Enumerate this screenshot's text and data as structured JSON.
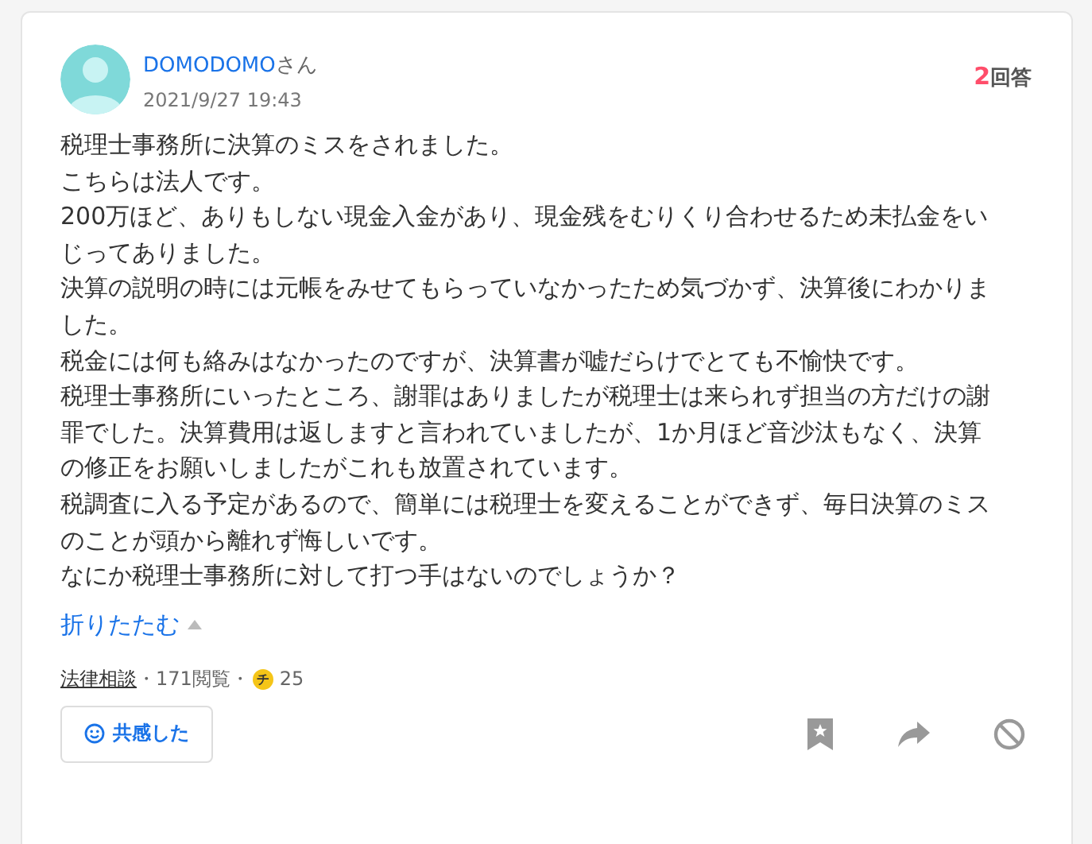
{
  "question": {
    "user_name": "DOMODOMO",
    "user_suffix": "さん",
    "date": "2021/9/27 19:43",
    "answer_count": "2",
    "answer_label": "回答",
    "body": [
      "税理士事務所に決算のミスをされました。",
      "こちらは法人です。",
      "200万ほど、ありもしない現金入金があり、現金残をむりくり合わせるため未払金をいじってありました。",
      "決算の説明の時には元帳をみせてもらっていなかったため気づかず、決算後にわかりました。",
      "税金には何も絡みはなかったのですが、決算書が嘘だらけでとても不愉快です。",
      "税理士事務所にいったところ、謝罪はありましたが税理士は来られず担当の方だけの謝罪でした。決算費用は返しますと言われていましたが、1か月ほど音沙汰もなく、決算の修正をお願いしましたがこれも放置されています。",
      "税調査に入る予定があるので、簡単には税理士を変えることができず、毎日決算のミスのことが頭から離れず悔しいです。",
      "なにか税理士事務所に対して打つ手はないのでしょうか？"
    ],
    "collapse_label": "折りたたむ",
    "category": "法律相談",
    "views": "・171閲覧・",
    "coin_label": "チ",
    "coins": "25",
    "empathy_label": "共感した"
  }
}
